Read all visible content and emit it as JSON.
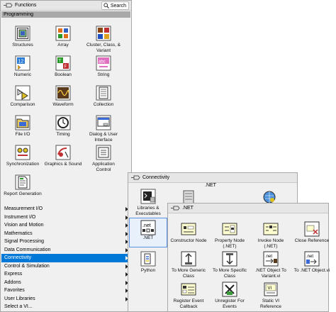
{
  "functions": {
    "title": "Functions",
    "search_label": "Search",
    "section": "Programming",
    "items": [
      {
        "label": "Structures",
        "icon": "structures-icon"
      },
      {
        "label": "Array",
        "icon": "array-icon"
      },
      {
        "label": "Cluster, Class, & Variant",
        "icon": "cluster-icon"
      },
      {
        "label": "Numeric",
        "icon": "numeric-icon"
      },
      {
        "label": "Boolean",
        "icon": "boolean-icon"
      },
      {
        "label": "String",
        "icon": "string-icon"
      },
      {
        "label": "Comparison",
        "icon": "comparison-icon"
      },
      {
        "label": "Waveform",
        "icon": "waveform-icon"
      },
      {
        "label": "Collection",
        "icon": "collection-icon"
      },
      {
        "label": "File I/O",
        "icon": "file-io-icon"
      },
      {
        "label": "Timing",
        "icon": "timing-icon"
      },
      {
        "label": "Dialog & User Interface",
        "icon": "dialog-icon"
      },
      {
        "label": "Synchronization",
        "icon": "synchronization-icon"
      },
      {
        "label": "Graphics & Sound",
        "icon": "graphics-icon"
      },
      {
        "label": "Application Control",
        "icon": "app-control-icon"
      },
      {
        "label": "Report Generation",
        "icon": "report-icon"
      }
    ],
    "categories": [
      "Measurement I/O",
      "Instrument I/O",
      "Vision and Motion",
      "Mathematics",
      "Signal Processing",
      "Data Communication",
      "Connectivity",
      "Control & Simulation",
      "Express",
      "Addons",
      "Favorites",
      "User Libraries",
      "Select a VI..."
    ],
    "active_category": "Connectivity"
  },
  "connectivity": {
    "title": "Connectivity",
    "items": [
      {
        "label": "Libraries & Executables",
        "icon": "libraries-icon"
      },
      {
        "label": ".NET",
        "icon": "dotnet-icon"
      },
      {
        "label": "Python",
        "icon": "python-icon"
      }
    ],
    "top_label": ".NET"
  },
  "dotnet": {
    "title": ".NET",
    "items": [
      {
        "label": "Constructor Node",
        "icon": "constructor-node-icon"
      },
      {
        "label": "Property Node (.NET)",
        "icon": "property-node-icon"
      },
      {
        "label": "Invoke Node (.NET)",
        "icon": "invoke-node-icon"
      },
      {
        "label": "Close Reference",
        "icon": "close-reference-icon"
      },
      {
        "label": "To More Generic Class",
        "icon": "generic-class-icon"
      },
      {
        "label": "To More Specific Class",
        "icon": "specific-class-icon"
      },
      {
        "label": ".NET Object To Variant.vi",
        "icon": "object-to-variant-icon"
      },
      {
        "label": "To .NET Object.vi",
        "icon": "to-net-object-icon"
      },
      {
        "label": "Register Event Callback",
        "icon": "register-event-icon"
      },
      {
        "label": "Unregister For Events",
        "icon": "unregister-events-icon"
      },
      {
        "label": "Static VI Reference",
        "icon": "static-vi-ref-icon"
      }
    ]
  },
  "colors": {
    "selection": "#0078d7",
    "section_bar": "#a9a9a9",
    "panel": "#f0f0f0"
  }
}
